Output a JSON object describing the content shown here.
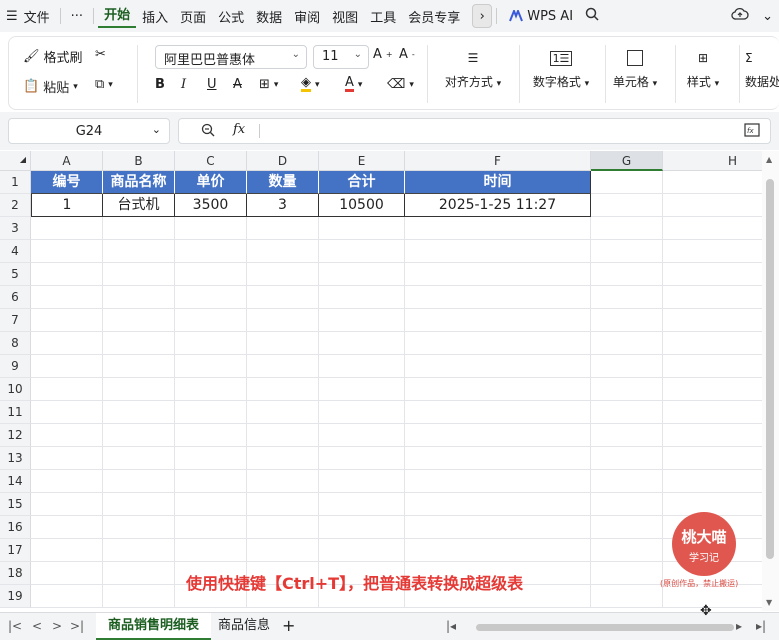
{
  "menubar": {
    "file_label": "文件",
    "more_label": "···",
    "tabs": [
      "开始",
      "插入",
      "页面",
      "公式",
      "数据",
      "审阅",
      "视图",
      "工具",
      "会员专享"
    ],
    "wps_ai_label": "WPS AI"
  },
  "ribbon": {
    "format_painter": "格式刷",
    "paste": "粘贴",
    "font_name": "阿里巴巴普惠体",
    "font_size": "11",
    "align_label": "对齐方式",
    "number_format_label": "数字格式",
    "cell_label": "单元格",
    "style_label": "样式",
    "data_process_label": "数据处"
  },
  "formula": {
    "cell_ref": "G24",
    "fx_label": "fx",
    "value": ""
  },
  "grid": {
    "columns": [
      "A",
      "B",
      "C",
      "D",
      "E",
      "F",
      "G",
      "H"
    ],
    "rows": [
      "1",
      "2",
      "3",
      "4",
      "5",
      "6",
      "7",
      "8",
      "9",
      "10",
      "11",
      "12",
      "13",
      "14",
      "15",
      "16",
      "17",
      "18",
      "19"
    ],
    "header_cells": [
      "编号",
      "商品名称",
      "单价",
      "数量",
      "合计",
      "时间"
    ],
    "data_row": [
      "1",
      "台式机",
      "3500",
      "3",
      "10500",
      "2025-1-25 11:27"
    ],
    "header_fill": "#4472c4"
  },
  "overlay": {
    "caption": "使用快捷键【Ctrl+T】，把普通表转换成超级表",
    "stamp_line1": "桃大喵",
    "stamp_line2": "学习记",
    "stamp_note": "(原创作品，禁止搬运)"
  },
  "sheets": {
    "tabs": [
      "商品销售明细表",
      "商品信息"
    ],
    "add_label": "+"
  }
}
